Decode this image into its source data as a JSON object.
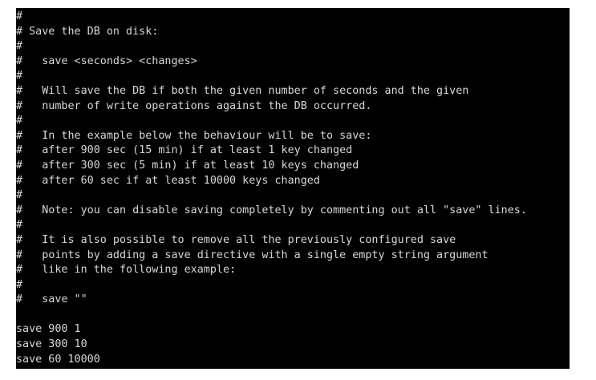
{
  "terminal": {
    "lines": [
      "#",
      "# Save the DB on disk:",
      "#",
      "#   save <seconds> <changes>",
      "#",
      "#   Will save the DB if both the given number of seconds and the given",
      "#   number of write operations against the DB occurred.",
      "#",
      "#   In the example below the behaviour will be to save:",
      "#   after 900 sec (15 min) if at least 1 key changed",
      "#   after 300 sec (5 min) if at least 10 keys changed",
      "#   after 60 sec if at least 10000 keys changed",
      "#",
      "#   Note: you can disable saving completely by commenting out all \"save\" lines.",
      "#",
      "#   It is also possible to remove all the previously configured save",
      "#   points by adding a save directive with a single empty string argument",
      "#   like in the following example:",
      "#",
      "#   save \"\"",
      "",
      "save 900 1",
      "save 300 10",
      "save 60 10000"
    ]
  }
}
